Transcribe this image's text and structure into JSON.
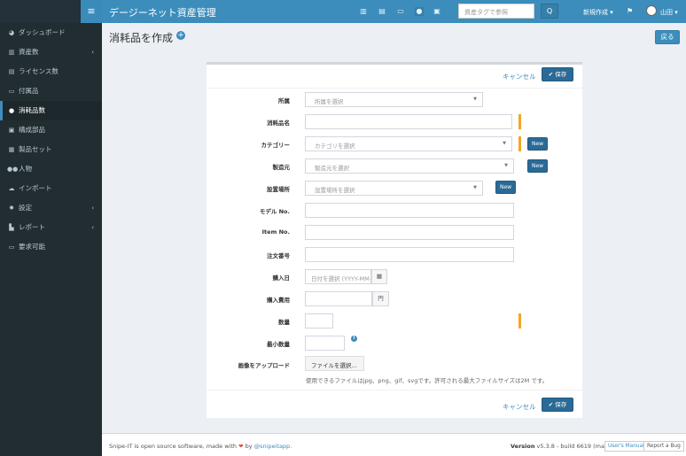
{
  "topbar": {
    "menu_glyph": "≡",
    "app_title": "デージーネット資産管理",
    "search_placeholder": "資産タグで参照",
    "search_glyph": "Q",
    "create_new": "新規作成 ▾",
    "user_name": "山田 ▾",
    "icons": [
      "barcode-icon",
      "license-icon",
      "keyboard-icon",
      "drop-icon",
      "hdd-icon",
      "flag-icon"
    ]
  },
  "sidebar": {
    "items": [
      {
        "label": "ダッシュボード",
        "icon": "dashboard-icon",
        "chev": ""
      },
      {
        "label": "資産数",
        "icon": "barcode-icon",
        "chev": "‹"
      },
      {
        "label": "ライセンス数",
        "icon": "save-icon",
        "chev": ""
      },
      {
        "label": "付属品",
        "icon": "keyboard-icon",
        "chev": ""
      },
      {
        "label": "消耗品数",
        "icon": "tint-icon",
        "chev": "",
        "active": true
      },
      {
        "label": "構成部品",
        "icon": "hdd-icon",
        "chev": ""
      },
      {
        "label": "製品セット",
        "icon": "object-group-icon",
        "chev": ""
      },
      {
        "label": "人物",
        "icon": "users-icon",
        "chev": ""
      },
      {
        "label": "インポート",
        "icon": "cloud-upload-icon",
        "chev": ""
      },
      {
        "label": "設定",
        "icon": "cog-icon",
        "chev": "‹"
      },
      {
        "label": "レポート",
        "icon": "chart-icon",
        "chev": "‹"
      },
      {
        "label": "要求可能",
        "icon": "laptop-icon",
        "chev": ""
      }
    ]
  },
  "page": {
    "title": "消耗品を作成",
    "back_label": "戻る",
    "cancel_label": "キャンセル",
    "save_label": "✔ 保存"
  },
  "form": {
    "company": {
      "label": "所属",
      "placeholder": "所属を選択"
    },
    "name": {
      "label": "消耗品名",
      "value": ""
    },
    "category": {
      "label": "カテゴリー",
      "placeholder": "カテゴリを選択"
    },
    "manufacturer": {
      "label": "製造元",
      "placeholder": "製造元を選択"
    },
    "location": {
      "label": "設置場所",
      "placeholder": "設置場所を選択"
    },
    "model_number": {
      "label": "モデル No.",
      "value": ""
    },
    "item_no": {
      "label": "Item No.",
      "value": ""
    },
    "order_number": {
      "label": "注文番号",
      "value": ""
    },
    "purchase_date": {
      "label": "購入日",
      "placeholder": "日付を選択 (YYYY-MM-DD)"
    },
    "purchase_cost": {
      "label": "購入費用",
      "currency": "円"
    },
    "qty": {
      "label": "数量"
    },
    "min_amt": {
      "label": "最小数量"
    },
    "image": {
      "label": "画像をアップロード",
      "button": "ファイルを選択...",
      "help": "使用できるファイルはjpg、png、gif、svgです。許可される最大ファイルサイズは2M です。"
    },
    "new_label": "New"
  },
  "footer": {
    "left_1": "Snipe-IT is open source software, made with ",
    "heart": "❤",
    "left_2": " by ",
    "handle": "@snipeitapp.",
    "version_label": "Version",
    "version_value": " v5.3.8 - build 6619 (master)",
    "manual": "User's Manual",
    "bug": "Report a Bug"
  },
  "colors": {
    "primary": "#3c8dbc",
    "sidebar": "#222d32",
    "required": "#f5a623"
  }
}
